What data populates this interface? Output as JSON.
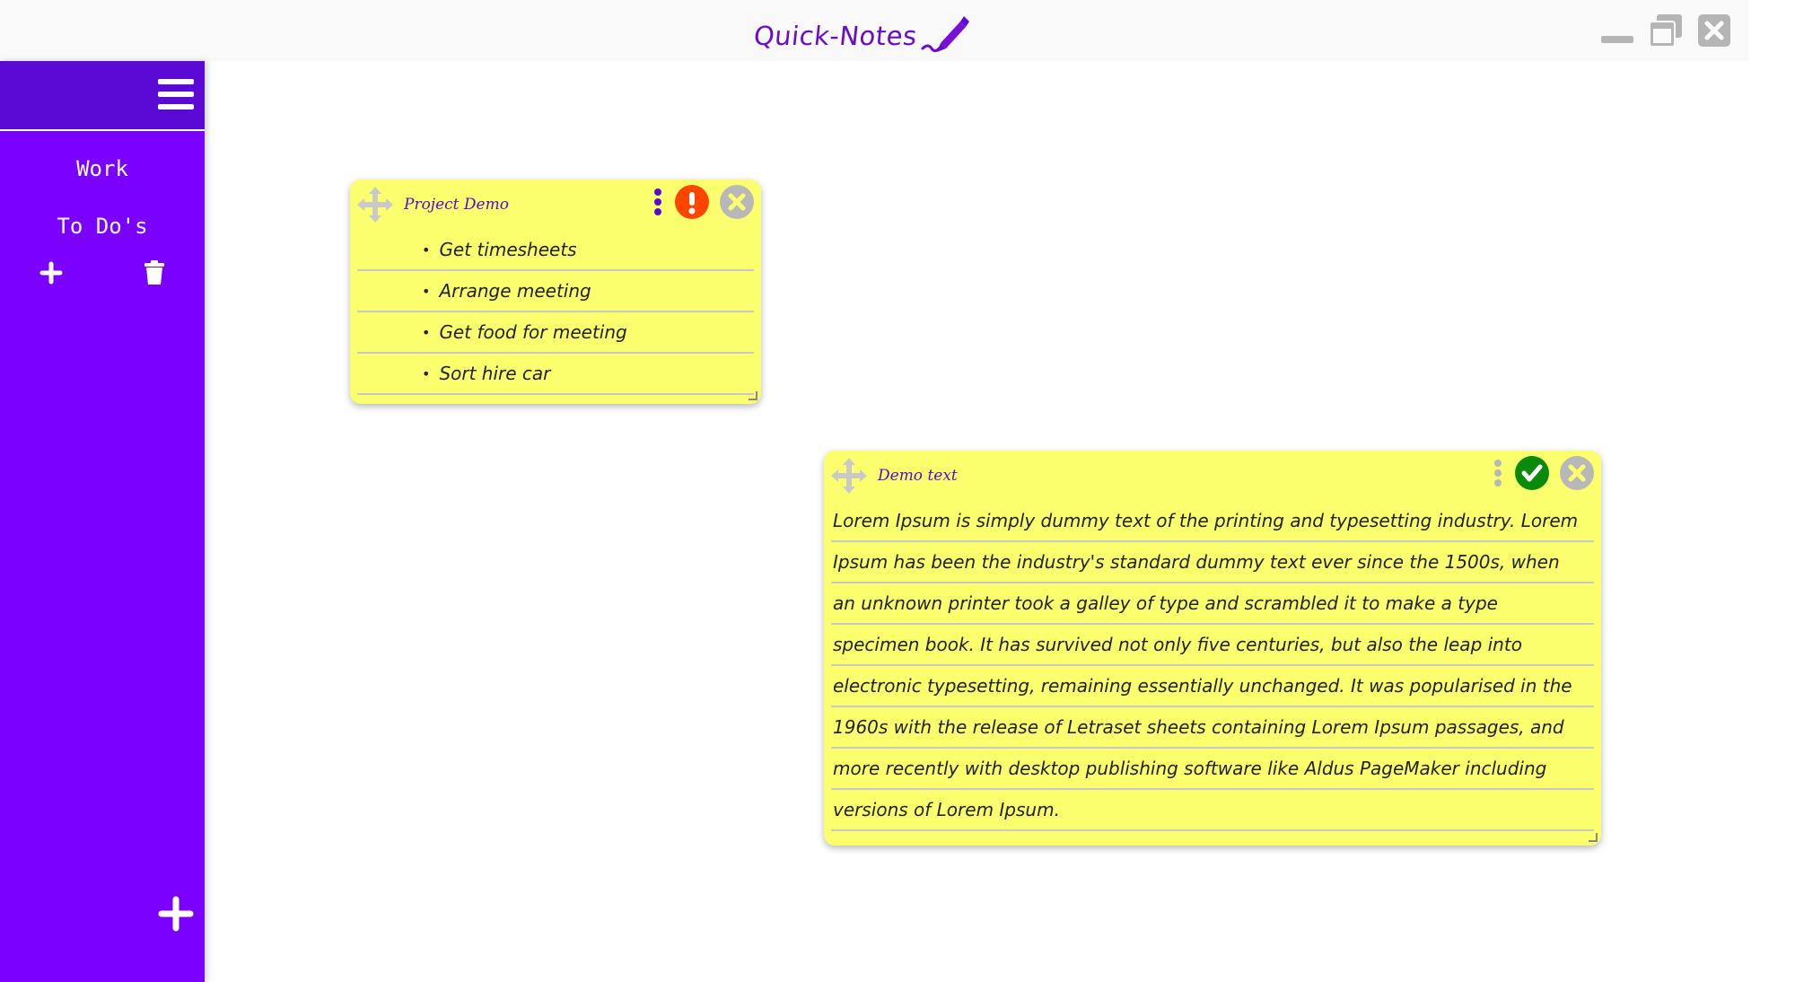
{
  "app": {
    "title": "Quick-Notes"
  },
  "colors": {
    "sidebar": "#7a00ff",
    "sidebar_header": "#5b0ad6",
    "note_bg": "#fbff6e",
    "accent_text": "#5a0ac9",
    "alert": "#ff4500",
    "done": "#0a8a0a",
    "close_gray": "#b8b8b8"
  },
  "sidebar": {
    "items": [
      {
        "label": "Work"
      },
      {
        "label": "To Do's"
      }
    ]
  },
  "notes": [
    {
      "title": "Project Demo",
      "status_icon": "exclamation-icon",
      "items": [
        "Get timesheets",
        "Arrange meeting",
        "Get food for meeting",
        "Sort hire car"
      ]
    },
    {
      "title": "Demo text",
      "status_icon": "check-icon",
      "lines": [
        "Lorem Ipsum is simply dummy text of the printing and typesetting industry. Lorem",
        "Ipsum has been the industry's standard dummy text ever since the 1500s, when",
        "an unknown printer took a galley of type and scrambled it to make a type",
        "specimen book. It has survived not only five centuries, but also the leap into",
        "electronic typesetting, remaining essentially unchanged. It was popularised in the",
        "1960s with the release of Letraset sheets containing Lorem Ipsum passages, and",
        "more recently with desktop publishing software like Aldus PageMaker including",
        "versions of Lorem Ipsum."
      ]
    }
  ]
}
